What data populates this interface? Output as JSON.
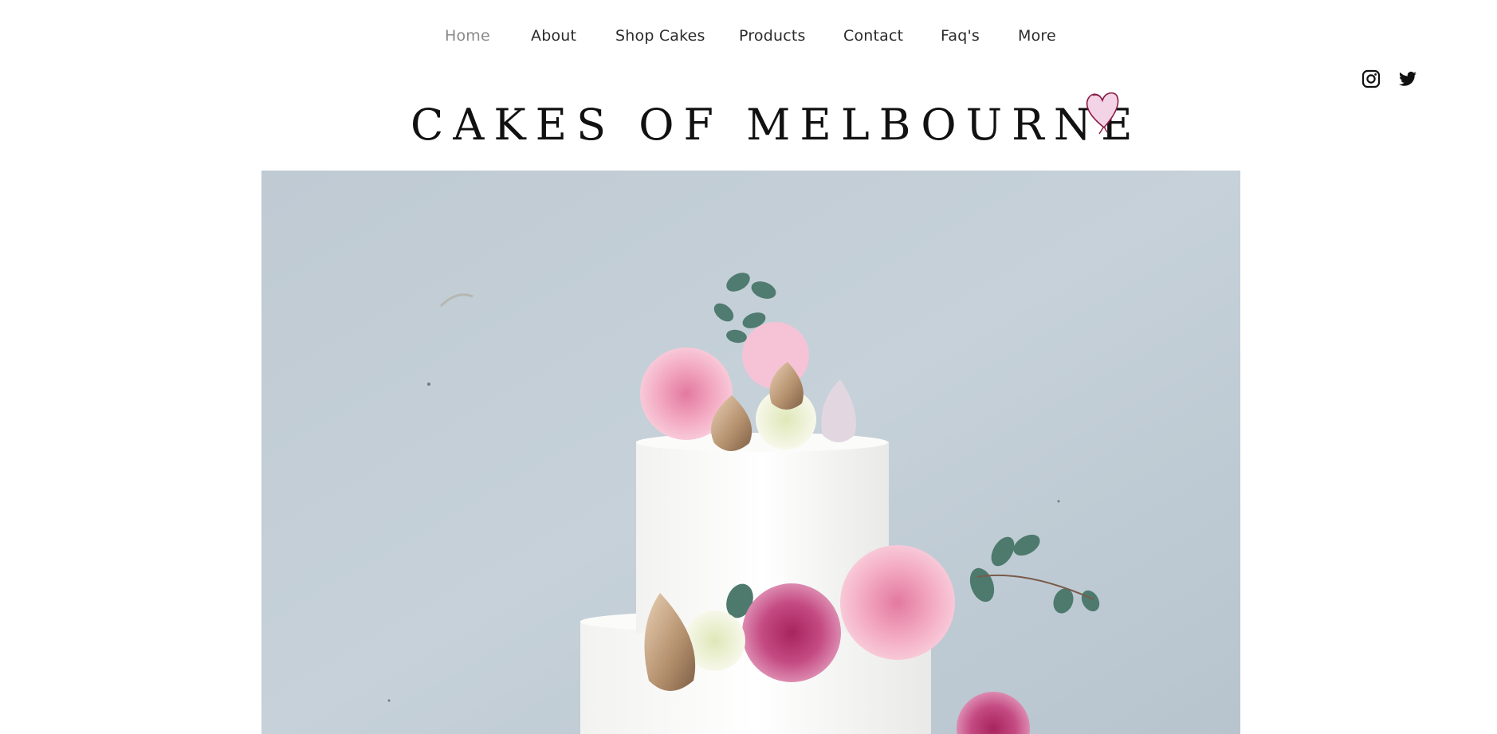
{
  "nav": {
    "items": [
      {
        "label": "Home",
        "active": true
      },
      {
        "label": "About"
      },
      {
        "label": "Shop Cakes"
      },
      {
        "label": "Products"
      },
      {
        "label": "Contact"
      },
      {
        "label": "Faq's"
      },
      {
        "label": "More"
      }
    ]
  },
  "social": {
    "icons": [
      "instagram-icon",
      "twitter-icon"
    ]
  },
  "brand": {
    "title": "CAKES OF MELBOURNE",
    "logo_icon": "heart-icon"
  },
  "hero": {
    "image": "tiered-white-cake-with-pink-roses"
  },
  "colors": {
    "nav_text": "#2b2b2b",
    "nav_active": "#8a8a8a",
    "hero_background": "#c3ced6",
    "heart_fill": "#f3d3e6",
    "heart_stroke": "#8b1a44"
  }
}
